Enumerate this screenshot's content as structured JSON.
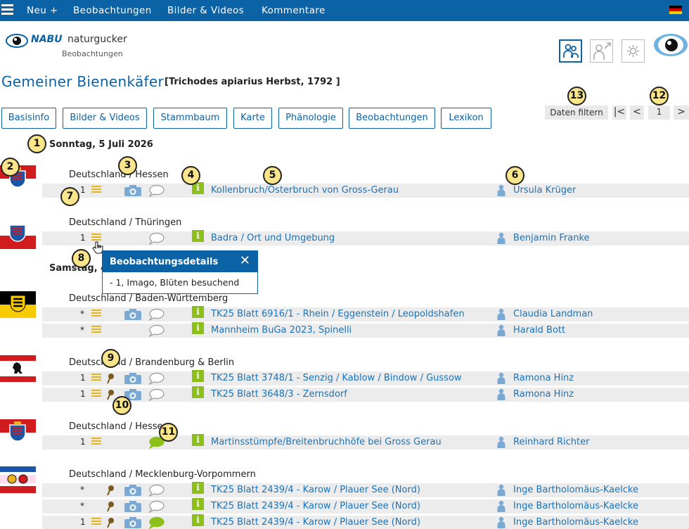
{
  "topnav": {
    "new": "Neu +",
    "observations": "Beobachtungen",
    "media": "Bilder & Videos",
    "comments": "Kommentare"
  },
  "logo": {
    "brand": "NABU",
    "name": "naturgucker",
    "subtitle": "Beobachtungen"
  },
  "page": {
    "title": "Gemeiner Bienenkäfer",
    "latin": "[Trichodes apiarius Herbst, 1792 ]"
  },
  "tabs": [
    "Basisinfo",
    "Bilder & Videos",
    "Stammbaum",
    "Karte",
    "Phänologie",
    "Beobachtungen",
    "Lexikon"
  ],
  "filter_label": "Daten filtern",
  "pager": {
    "first": "|<",
    "prev": "<",
    "page": "1",
    "next": ">"
  },
  "dates": [
    "Sonntag, 5 Juli 2026",
    "Samstag, 4"
  ],
  "groups": [
    {
      "region": "Deutschland / Hessen",
      "flag": "hessen",
      "rows": [
        {
          "count": "1",
          "lines": true,
          "pin": false,
          "cam": true,
          "bubble": "grey",
          "location": "Kollenbruch/Österbruch von Gross-Gerau",
          "user": "Ursula Krüger"
        }
      ]
    },
    {
      "region": "Deutschland / Thüringen",
      "flag": "thueringen",
      "rows": [
        {
          "count": "1",
          "lines": true,
          "pin": false,
          "cam": false,
          "bubble": "grey",
          "location": "Badra / Ort und Umgebung",
          "user": "Benjamin Franke"
        }
      ]
    },
    {
      "region": "Deutschland / Baden-Württemberg",
      "flag": "bw",
      "rows": [
        {
          "count": "*",
          "lines": true,
          "pin": false,
          "cam": true,
          "bubble": "grey",
          "location": "TK25 Blatt 6916/1 - Rhein / Eggenstein / Leopoldshafen",
          "user": "Claudia Landman"
        },
        {
          "count": "*",
          "lines": true,
          "pin": false,
          "cam": false,
          "bubble": "grey",
          "location": "Mannheim BuGa 2023, Spinelli",
          "user": "Harald Bott"
        }
      ]
    },
    {
      "region": "Deutschland / Brandenburg & Berlin",
      "flag": "berlin",
      "rows": [
        {
          "count": "1",
          "lines": true,
          "pin": true,
          "cam": true,
          "bubble": "grey",
          "location": "TK25 Blatt 3748/1 - Senzig / Kablow / Bindow / Gussow",
          "user": "Ramona Hinz"
        },
        {
          "count": "1",
          "lines": true,
          "pin": true,
          "cam": true,
          "bubble": "grey",
          "location": "TK25 Blatt 3648/3 - Zernsdorf",
          "user": "Ramona Hinz"
        }
      ]
    },
    {
      "region": "Deutschland / Hessen",
      "flag": "hessen",
      "rows": [
        {
          "count": "1",
          "lines": true,
          "pin": false,
          "cam": false,
          "bubble": "green",
          "location": "Martinsstümpfe/Breitenbruchhöfe bei Gross Gerau",
          "user": "Reinhard Richter"
        }
      ]
    },
    {
      "region": "Deutschland / Mecklenburg-Vorpommern",
      "flag": "mv",
      "rows": [
        {
          "count": "*",
          "lines": false,
          "pin": true,
          "cam": true,
          "bubble": "grey",
          "location": "TK25 Blatt 2439/4 - Karow / Plauer See (Nord)",
          "user": "Inge Bartholomäus-Kaelcke"
        },
        {
          "count": "*",
          "lines": false,
          "pin": true,
          "cam": true,
          "bubble": "grey",
          "location": "TK25 Blatt 2439/4 - Karow / Plauer See (Nord)",
          "user": "Inge Bartholomäus-Kaelcke"
        },
        {
          "count": "1",
          "lines": true,
          "pin": true,
          "cam": true,
          "bubble": "green",
          "location": "TK25 Blatt 2439/4 - Karow / Plauer See (Nord)",
          "user": "Inge Bartholomäus-Kaelcke"
        }
      ]
    }
  ],
  "popup": {
    "title": "Beobachtungsdetails",
    "close": "✕",
    "body": "- 1, Imago, Blüten besuchend"
  },
  "badges": [
    "1",
    "2",
    "3",
    "4",
    "5",
    "6",
    "7",
    "8",
    "9",
    "10",
    "11",
    "12",
    "13"
  ],
  "colors": {
    "primary": "#0b62a4",
    "link": "#1a73b8",
    "row": "#ececec",
    "info": "#8cbf1a",
    "badge": "#fbe58a"
  }
}
